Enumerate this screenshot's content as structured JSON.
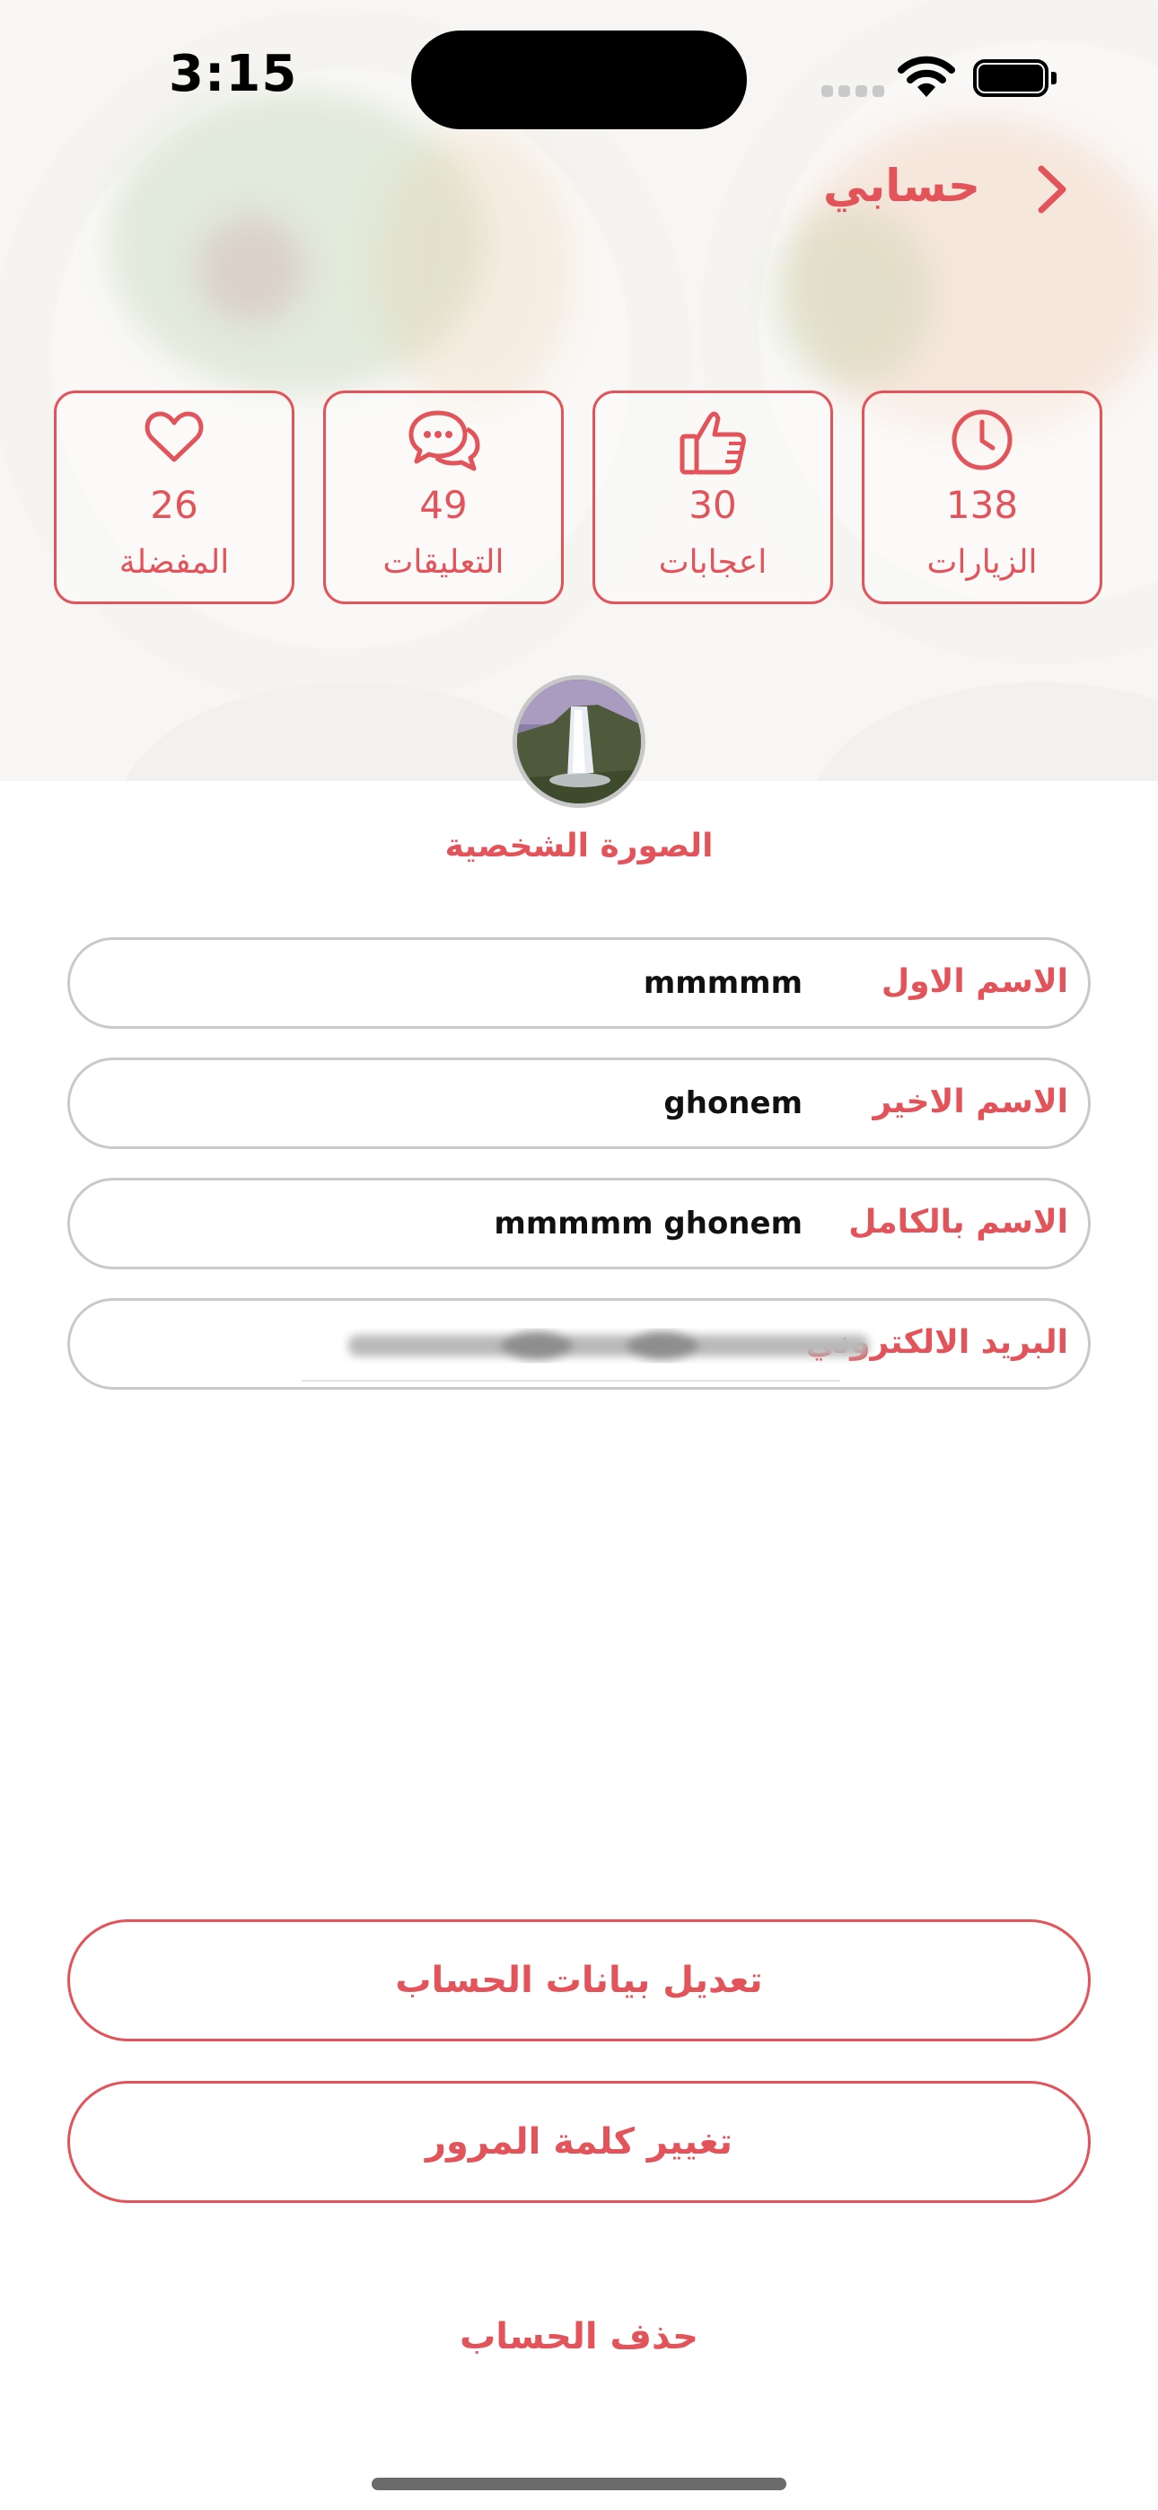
{
  "status_bar": {
    "time": "3:15"
  },
  "header": {
    "title": "حسابي",
    "back_icon": "chevron-right-icon"
  },
  "stats": [
    {
      "key": "visits",
      "value": "138",
      "label": "الزيارات",
      "icon": "clock-icon"
    },
    {
      "key": "likes",
      "value": "30",
      "label": "اعجابات",
      "icon": "thumbs-up-icon"
    },
    {
      "key": "comments",
      "value": "49",
      "label": "التعليقات",
      "icon": "chat-bubbles-icon"
    },
    {
      "key": "favorites",
      "value": "26",
      "label": "المفضلة",
      "icon": "heart-icon"
    }
  ],
  "profile": {
    "avatar_label": "الصورة الشخصية"
  },
  "fields": [
    {
      "key": "first_name",
      "label": "الاسم الاول",
      "value": "mmmmm"
    },
    {
      "key": "last_name",
      "label": "الاسم الاخير",
      "value": "ghonem"
    },
    {
      "key": "full_name",
      "label": "الاسم بالكامل",
      "value": "mmmmm ghonem"
    },
    {
      "key": "email",
      "label": "البريد الالكتروني",
      "value": ""
    }
  ],
  "actions": {
    "edit_account": "تعديل بيانات الحساب",
    "change_password": "تغيير كلمة المرور",
    "delete_account": "حذف الحساب"
  },
  "colors": {
    "accent": "#e3535a",
    "border": "#c9c9c9"
  }
}
